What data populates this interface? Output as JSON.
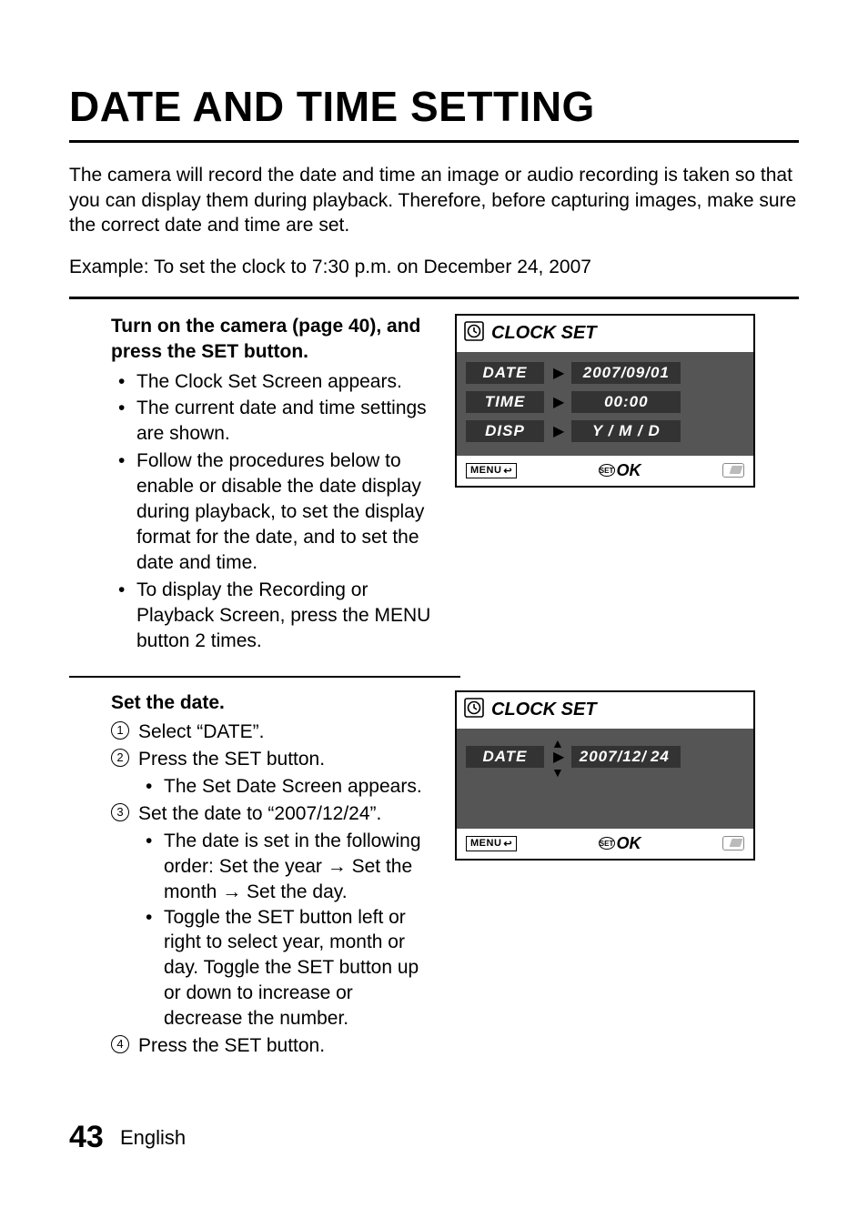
{
  "title": "DATE AND TIME SETTING",
  "intro1": "The camera will record the date and time an image or audio recording is taken so that you can display them during playback. Therefore, before capturing images, make sure the correct date and time are set.",
  "intro2": "Example: To set the clock to 7:30 p.m. on December 24, 2007",
  "step1": {
    "title": "Turn on the camera (page 40), and press the SET button.",
    "bullets": [
      "The Clock Set Screen appears.",
      "The current date and time settings are shown.",
      "Follow the procedures below to enable or disable the date display during playback, to set the display format for the date, and to set the date and time.",
      "To display the Recording or Playback Screen, press the MENU button 2 times."
    ]
  },
  "step2": {
    "title": "Set the date.",
    "items": {
      "i1": "Select “DATE”.",
      "i2": "Press the SET button.",
      "i2s": "The Set Date Screen appears.",
      "i3": "Set the date to “2007/12/24”.",
      "i3s1": "The date is set in the following order: Set the year → Set the month → Set the day.",
      "i3s2": "Toggle the SET button left or right to select year, month or day. Toggle the SET button up or down to increase or decrease the number.",
      "i4": "Press the SET button."
    }
  },
  "lcd1": {
    "title": "CLOCK SET",
    "rows": {
      "date_l": "DATE",
      "date_v": "2007/09/01",
      "time_l": "TIME",
      "time_v": "00:00",
      "disp_l": "DISP",
      "disp_v": "Y / M / D"
    },
    "menu": "MENU",
    "ok": "OK"
  },
  "lcd2": {
    "title": "CLOCK SET",
    "date_l": "DATE",
    "date_prefix": "2007/12/",
    "date_sel": "24",
    "menu": "MENU",
    "ok": "OK"
  },
  "footer": {
    "page": "43",
    "lang": "English"
  }
}
